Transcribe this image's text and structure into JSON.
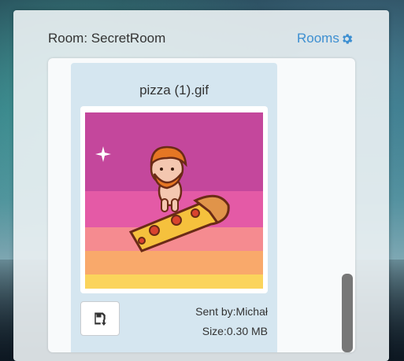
{
  "header": {
    "room_title": "Room: SecretRoom",
    "rooms_link_label": "Rooms"
  },
  "message": {
    "file_name": "pizza (1).gif",
    "sent_by": "Sent by:Michał",
    "size": "Size:0.30 MB"
  },
  "icons": {
    "gear": "gear-icon",
    "save": "floppy-download-icon"
  },
  "colors": {
    "accent": "#3d8fd1",
    "card": "#d5e6f0",
    "stripe_magenta": "#c4479c",
    "stripe_pink": "#e45aa6",
    "stripe_salmon": "#f58b90",
    "stripe_orange": "#f9a96b",
    "stripe_yellow": "#fbd45c"
  }
}
